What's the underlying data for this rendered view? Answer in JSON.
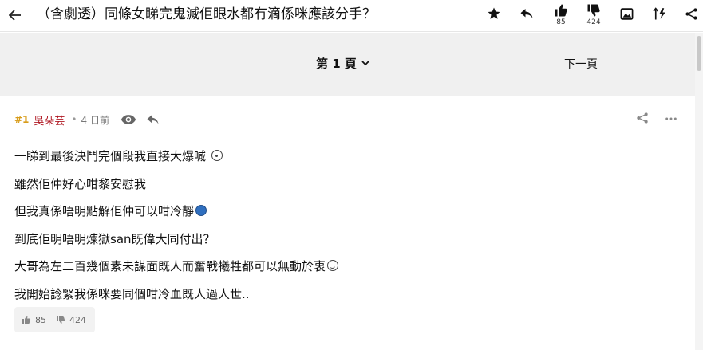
{
  "thread": {
    "title": "（含劇透）同條女睇完鬼滅佢眼水都冇滴係咪應該分手？",
    "like_count": "85",
    "dislike_count": "424"
  },
  "toolbar": {
    "icons": [
      "back-arrow-icon",
      "star-icon",
      "reply-icon",
      "thumbs-up-icon",
      "thumbs-down-icon",
      "image-icon",
      "sort-icon",
      "share-icon"
    ]
  },
  "pager": {
    "current_page": "第 1 頁",
    "next_page": "下一頁"
  },
  "post": {
    "number": "#1",
    "author": "吳朵芸",
    "dot": "•",
    "time": "4 日前",
    "lines": [
      "一睇到最後決鬥完個段我直接大爆喊",
      "雖然佢仲好心咁黎安慰我",
      "但我真係唔明點解佢仲可以咁冷靜",
      "到底佢明唔明煉獄san既偉大同付出？",
      "大哥為左二百幾個素未謀面既人而奮戰犧牲都可以無動於衷",
      "我開始諗緊我係咪要同個咁冷血既人過人世.."
    ],
    "like_count": "85",
    "dislike_count": "424"
  },
  "colors": {
    "post_number": "#d89c1a",
    "author": "#b01a24",
    "pager_bg": "#f0f0f0"
  }
}
